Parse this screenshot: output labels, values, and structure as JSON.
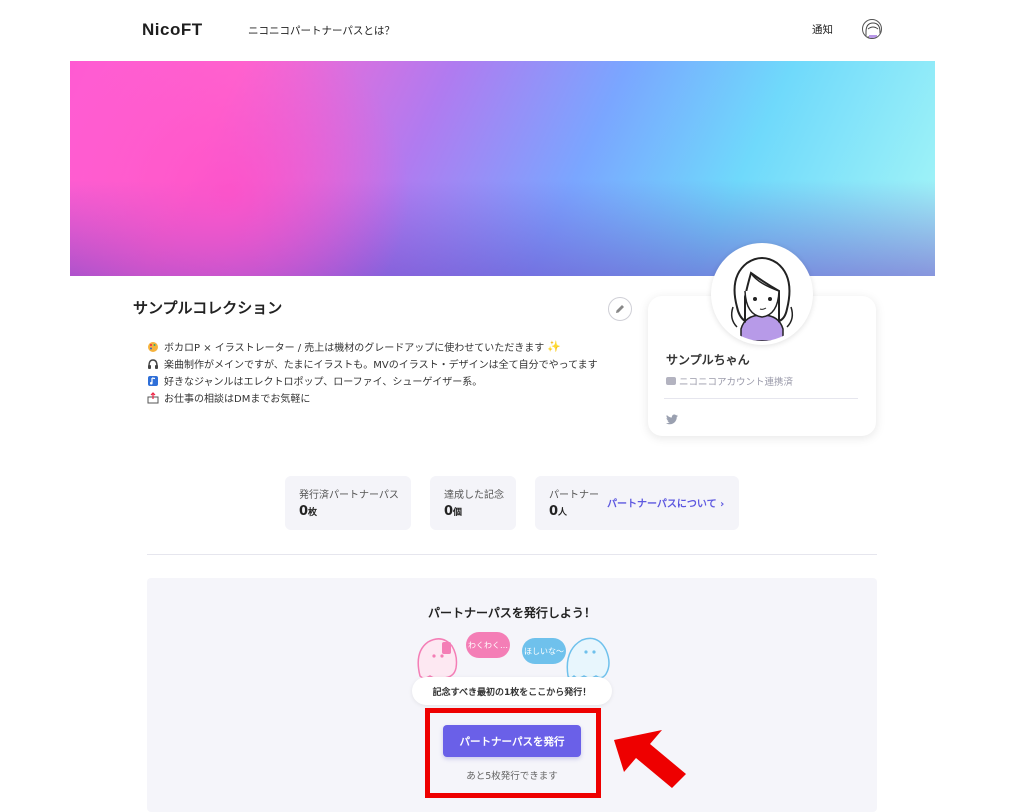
{
  "header": {
    "logo": "NicoFT",
    "about_link": "ニコニコパートナーパスとは？",
    "notifications": "通知",
    "avatar_icon": "user-avatar-icon"
  },
  "collection": {
    "title": "サンプルコレクション",
    "edit_icon": "pencil-icon",
    "bio": [
      {
        "icon": "palette-icon",
        "text": "ボカロP × イラストレーター / 売上は機材のグレードアップに使わせていただきます"
      },
      {
        "icon": "headphones-icon",
        "text": "楽曲制作がメインですが、たまにイラストも。MVのイラスト・デザインは全て自分でやってます"
      },
      {
        "icon": "music-note-icon",
        "text": "好きなジャンルはエレクトロポップ、ローファイ、シューゲイザー系。"
      },
      {
        "icon": "outbox-icon",
        "text": "お仕事の相談はDMまでお気軽に"
      }
    ]
  },
  "profile": {
    "name": "サンプルちゃん",
    "account_status": "ニコニコアカウント連携済",
    "social_icon": "twitter-icon"
  },
  "stats": {
    "issued": {
      "label": "発行済パートナーパス",
      "value": "0",
      "unit": "枚"
    },
    "achieved": {
      "label": "達成した記念",
      "value": "0",
      "unit": "個"
    },
    "partners": {
      "label": "パートナー",
      "value": "0",
      "unit": "人"
    },
    "about_link": "パートナーパスについて ›"
  },
  "issue_panel": {
    "title": "パートナーパスを発行しよう！",
    "bubble_left": "わくわく…",
    "bubble_right": "ほしいな〜",
    "callout": "記念すべき最初の1枚をここから発行！",
    "button_label": "パートナーパスを発行",
    "remaining": "あと5枚発行できます"
  },
  "colors": {
    "accent": "#6a60e8",
    "highlight": "#ee0000",
    "link": "#5d58e0"
  }
}
